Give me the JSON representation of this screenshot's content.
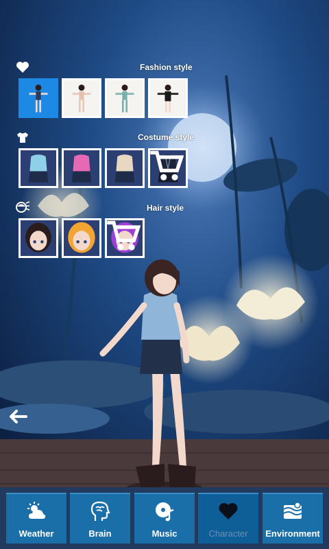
{
  "sections": {
    "fashion": {
      "title": "Fashion style",
      "icon": "heart-icon",
      "selected_index": 0
    },
    "costume": {
      "title": "Costume style",
      "icon": "shirt-icon",
      "locked_index": 3
    },
    "hair": {
      "title": "Hair style",
      "icon": "hair-style-icon",
      "locked_index": 2
    }
  },
  "back": {
    "icon": "back-arrow-icon"
  },
  "nav": [
    {
      "label": "Weather",
      "icon": "weather-icon"
    },
    {
      "label": "Brain",
      "icon": "brain-icon"
    },
    {
      "label": "Music",
      "icon": "music-icon"
    },
    {
      "label": "Character",
      "icon": "heart-icon",
      "active": true
    },
    {
      "label": "Environment",
      "icon": "environment-icon"
    }
  ],
  "colors": {
    "selected_tile": "#1e88e5",
    "nav_button": "#1b6fa8",
    "nav_active": "#0e5f97",
    "inactive_label": "#6f8fb4"
  }
}
